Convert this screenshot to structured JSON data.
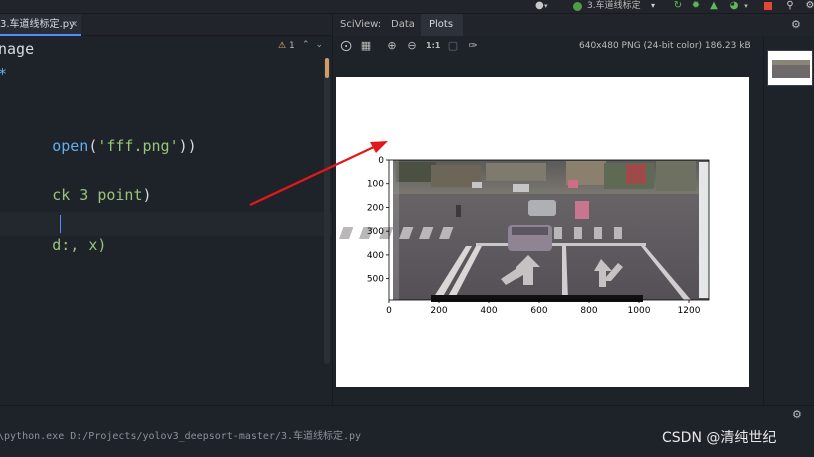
{
  "toolbar": {
    "run_config": "3.车道线标定",
    "icons": [
      "user-icon",
      "run-config-icon",
      "rerun-icon",
      "debug-icon",
      "coverage-icon",
      "profile-icon",
      "stop-icon",
      "search-icon",
      "settings-icon"
    ],
    "colors": {
      "run": "#4f9d49",
      "debug": "#5fb85a",
      "stop": "#e4463b"
    }
  },
  "editor": {
    "tab_label": "3.车道线标定.py",
    "warning_count": "1",
    "code_lines": [
      {
        "text": "nage",
        "top": 2
      },
      {
        "text": "*",
        "top": 27
      },
      {
        "text": "open('fff.png'))",
        "top": 77
      },
      {
        "text": "ck 3 point')",
        "top": 126
      },
      {
        "text": "d:', x)",
        "top": 176
      }
    ]
  },
  "sciview": {
    "title": "SciView:",
    "tab_data": "Data",
    "tab_plots": "Plots",
    "image_info": "640x480 PNG (24-bit color) 186.23 kB"
  },
  "bottom": {
    "run_command": "\\python.exe D:/Projects/yolov3_deepsort-master/3.车道线标定.py"
  },
  "watermark": "CSDN @清纯世纪",
  "chart_data": {
    "type": "image",
    "x_ticks": [
      "0",
      "200",
      "400",
      "600",
      "800",
      "1000",
      "1200"
    ],
    "y_ticks": [
      "0",
      "100",
      "200",
      "300",
      "400",
      "500"
    ],
    "xlim": [
      0,
      1280
    ],
    "ylim": [
      590,
      0
    ],
    "annotation": "red-arrow"
  }
}
